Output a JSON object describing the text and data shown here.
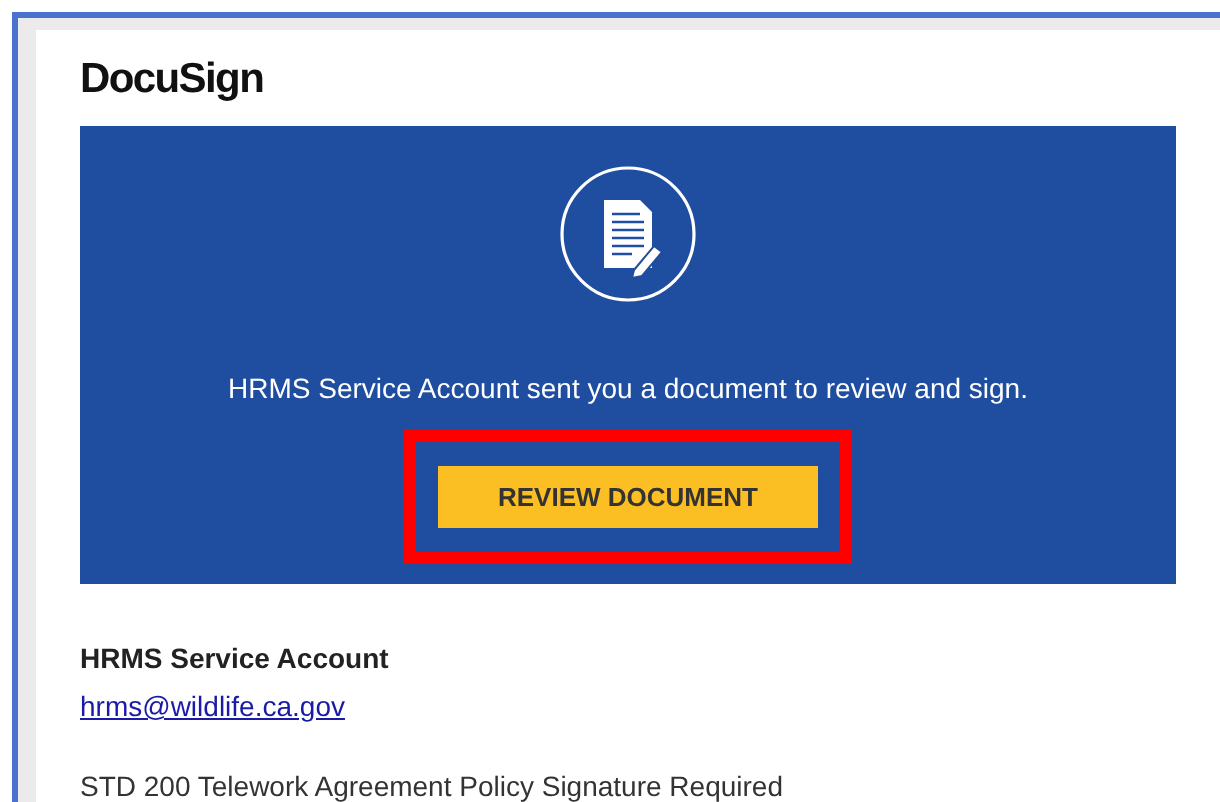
{
  "logo": {
    "text": "DocuSign"
  },
  "banner": {
    "message": "HRMS Service Account sent you a document to review and sign.",
    "button": {
      "label": "REVIEW DOCUMENT",
      "highlighted": true
    }
  },
  "sender": {
    "name": "HRMS Service Account",
    "email": "hrms@wildlife.ca.gov"
  },
  "subject": "STD 200 Telework Agreement Policy Signature Required"
}
